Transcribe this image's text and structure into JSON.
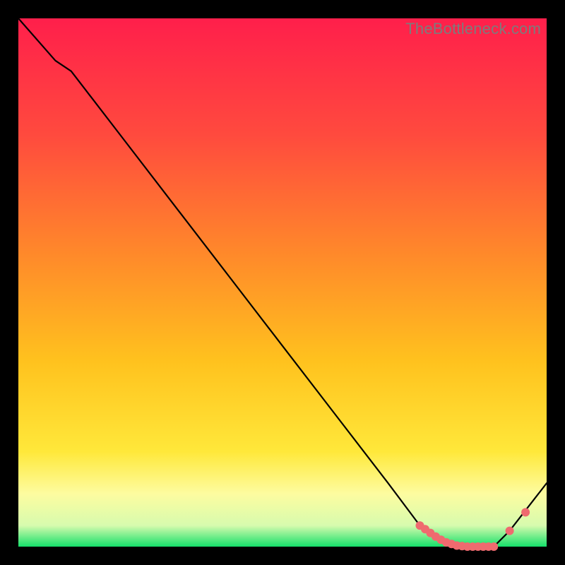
{
  "attribution": "TheBottleneck.com",
  "colors": {
    "gradient": [
      "#ff1f4b",
      "#ff4a3e",
      "#ff8a2a",
      "#ffc21e",
      "#ffe83a",
      "#fdfca0",
      "#d7fbae",
      "#15e06a"
    ],
    "curve": "#000000",
    "marker": "#ef6a6f"
  },
  "chart_data": {
    "type": "line",
    "title": "",
    "xlabel": "",
    "ylabel": "",
    "xlim": [
      0,
      100
    ],
    "ylim": [
      0,
      100
    ],
    "grid": false,
    "legend": false,
    "series": [
      {
        "name": "curve",
        "x": [
          0,
          7,
          10,
          20,
          30,
          40,
          50,
          60,
          70,
          76,
          80,
          85,
          90,
          93,
          100
        ],
        "y": [
          100,
          92,
          90,
          77,
          64,
          51,
          38,
          25,
          12,
          4,
          1,
          0,
          0,
          3,
          12
        ]
      }
    ],
    "markers": {
      "name": "highlight-points",
      "x": [
        76,
        77,
        78,
        79,
        80,
        81,
        82,
        83,
        84,
        85,
        86,
        87,
        88,
        89,
        90,
        93,
        96
      ],
      "y": [
        4,
        3.3,
        2.6,
        1.9,
        1.3,
        0.8,
        0.5,
        0.2,
        0.1,
        0,
        0,
        0,
        0,
        0,
        0,
        3,
        6.5
      ]
    }
  }
}
